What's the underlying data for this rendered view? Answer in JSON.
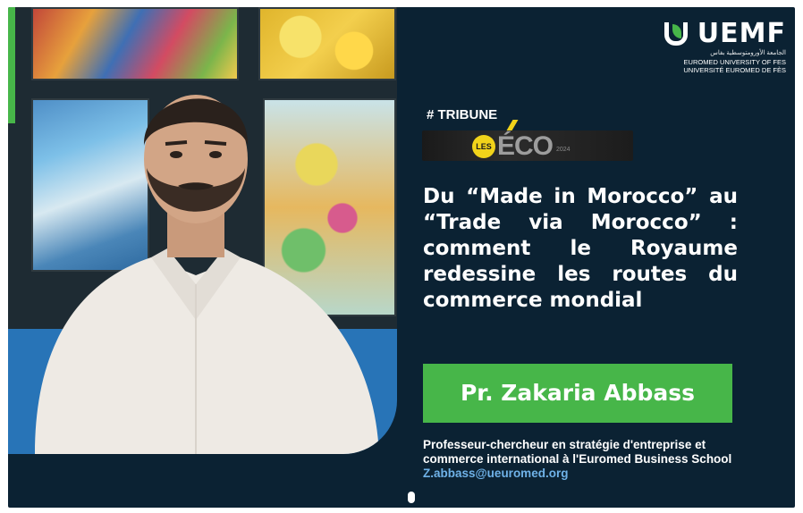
{
  "branding": {
    "logo_word": "UEMF",
    "arabic_line": "الجامعة الأورومتوسطية بفاس",
    "english_line": "EUROMED UNIVERSITY OF FES",
    "french_line": "UNIVERSITÉ EUROMED DE FÈS"
  },
  "tag": "# TRIBUNE",
  "publication": {
    "circle_text": "LES",
    "word": "ÉCO",
    "small": "2024"
  },
  "headline": "Du “Made in Morocco” au “Trade via Morocco” : comment le Royaume redessine les routes du commerce mondial",
  "author": {
    "name": "Pr. Zakaria Abbass",
    "title_line_1": "Professeur-chercheur en stratégie d'entreprise et",
    "title_line_2": "commerce international à l'Euromed Business School",
    "email": "Z.abbass@ueuromed.org"
  },
  "colors": {
    "background": "#0b2233",
    "accent_green": "#47b649",
    "email_blue": "#6fb2e8"
  },
  "icons": [
    "uemf-logo-icon",
    "les-eco-logo-icon",
    "carousel-dot-icon"
  ]
}
